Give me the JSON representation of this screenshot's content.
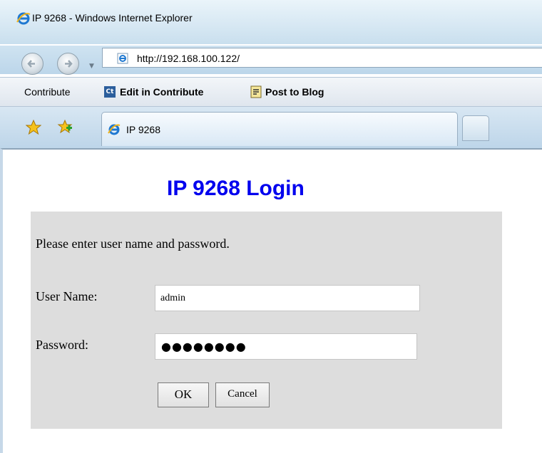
{
  "window": {
    "title": "IP 9268 - Windows Internet Explorer"
  },
  "nav": {
    "url": "http://192.168.100.122/"
  },
  "links_bar": {
    "contribute": "Contribute",
    "edit_in_contribute": "Edit in Contribute",
    "post_to_blog": "Post to Blog",
    "ct_badge": "Ct"
  },
  "tab": {
    "label": "IP 9268"
  },
  "page": {
    "heading": "IP 9268 Login",
    "instructions": "Please enter user name and password.",
    "user_label": "User Name:",
    "user_value": "admin",
    "pass_label": "Password:",
    "pass_value": "●●●●●●●●",
    "ok_label": "OK",
    "cancel_label": "Cancel"
  },
  "colors": {
    "heading": "#0000ee",
    "login_box": "#dddddd"
  },
  "icons": {
    "title": "ie-icon",
    "address": "ie-page-icon",
    "favorites": "favorites-star-icon",
    "add_favorite": "add-favorite-icon",
    "tab": "ie-icon"
  }
}
